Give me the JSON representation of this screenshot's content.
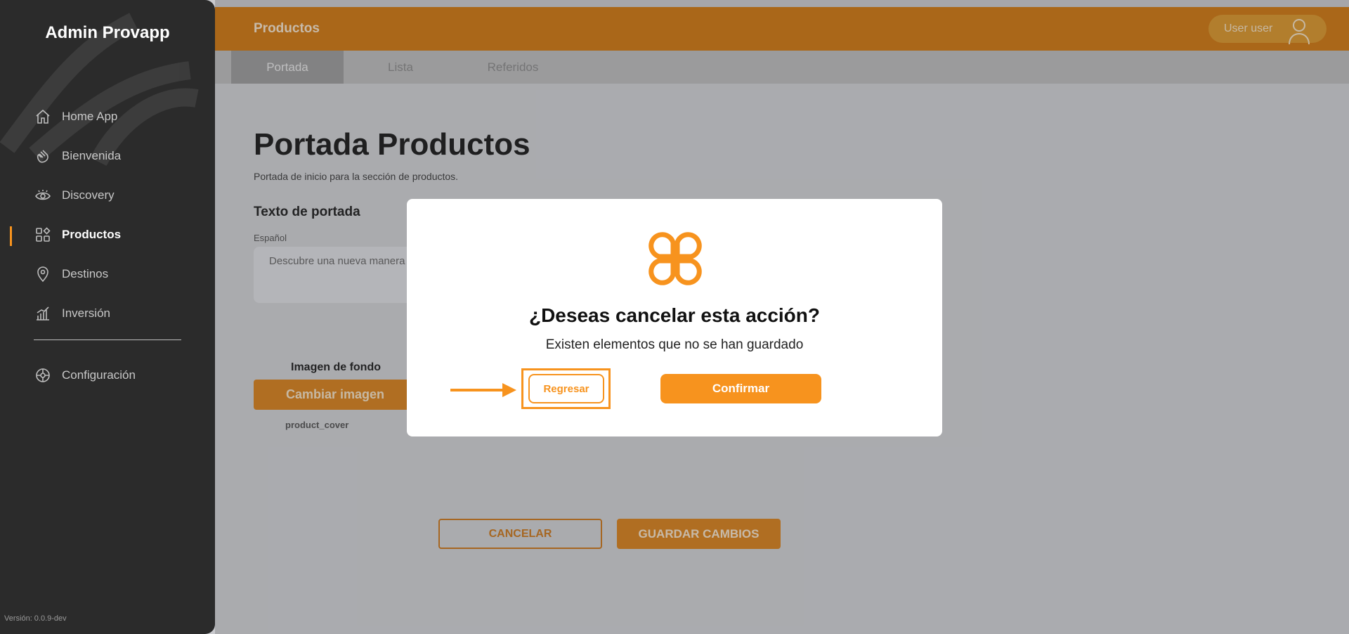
{
  "app": {
    "title": "Admin Provapp",
    "version": "Versión: 0.0.9-dev"
  },
  "sidebar": {
    "items": [
      {
        "label": "Home App",
        "icon": "home-icon"
      },
      {
        "label": "Bienvenida",
        "icon": "wave-hand-icon"
      },
      {
        "label": "Discovery",
        "icon": "eye-icon"
      },
      {
        "label": "Productos",
        "icon": "grid-icon",
        "active": true
      },
      {
        "label": "Destinos",
        "icon": "location-pin-icon"
      },
      {
        "label": "Inversión",
        "icon": "bar-chart-icon"
      }
    ],
    "config": {
      "label": "Configuración",
      "icon": "gear-icon"
    }
  },
  "header": {
    "title": "Productos",
    "user": "User user"
  },
  "tabs": [
    {
      "label": "Portada",
      "active": true
    },
    {
      "label": "Lista"
    },
    {
      "label": "Referidos"
    }
  ],
  "main": {
    "page_title": "Portada Productos",
    "subtitle": "Portada de inicio para la sección de productos.",
    "section_title": "Texto de portada",
    "field_label": "Español",
    "field_value": "Descubre una nueva manera",
    "image_label": "Imagen de fondo",
    "change_image": "Cambiar imagen",
    "file_name": "product_cover",
    "cancel": "CANCELAR",
    "save": "GUARDAR CAMBIOS"
  },
  "modal": {
    "question": "¿Deseas cancelar esta acción?",
    "message": "Existen elementos que no se han guardado",
    "back": "Regresar",
    "confirm": "Confirmar"
  },
  "colors": {
    "accent": "#f7931e",
    "sidebar": "#2b2b2b",
    "topbar": "#cf7914"
  }
}
